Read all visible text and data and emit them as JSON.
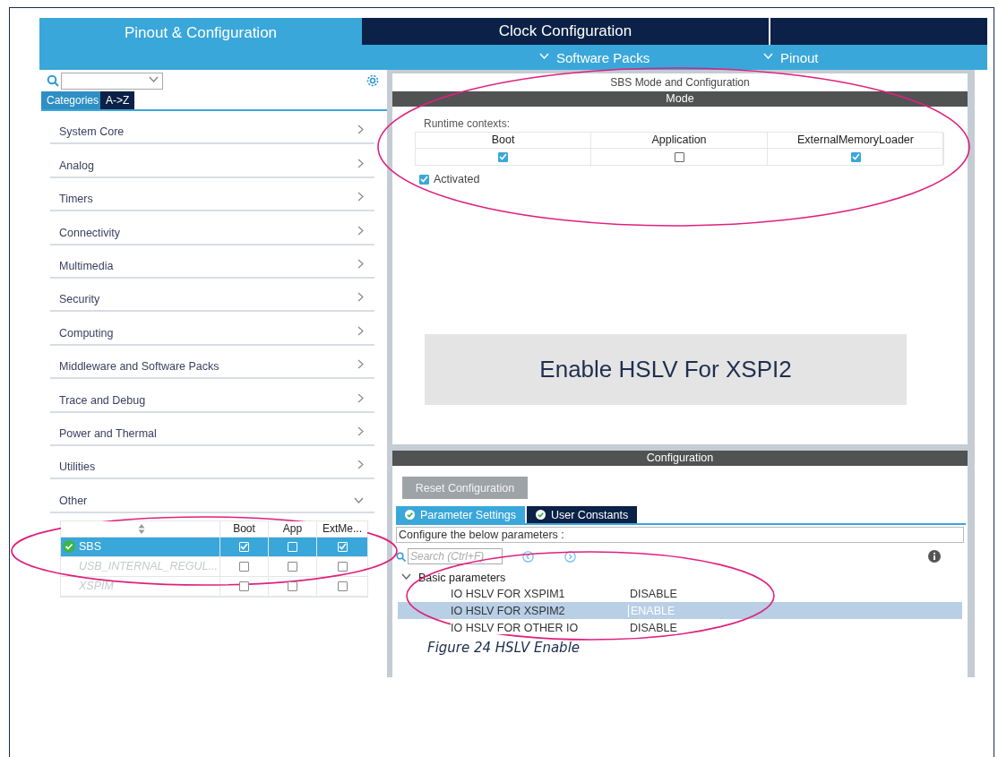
{
  "top_tabs": [
    {
      "label": "Pinout & Configuration",
      "selected": true
    },
    {
      "label": "Clock Configuration",
      "selected": false
    }
  ],
  "sub_menus": [
    {
      "label": "Software Packs"
    },
    {
      "label": "Pinout"
    }
  ],
  "sidebar": {
    "view_tabs": [
      {
        "label": "Categories",
        "selected": true
      },
      {
        "label": "A->Z",
        "selected": false
      }
    ],
    "categories": [
      {
        "label": "System Core",
        "expanded": false
      },
      {
        "label": "Analog",
        "expanded": false
      },
      {
        "label": "Timers",
        "expanded": false
      },
      {
        "label": "Connectivity",
        "expanded": false
      },
      {
        "label": "Multimedia",
        "expanded": false
      },
      {
        "label": "Security",
        "expanded": false
      },
      {
        "label": "Computing",
        "expanded": false
      },
      {
        "label": "Middleware and Software Packs",
        "expanded": false
      },
      {
        "label": "Trace and Debug",
        "expanded": false
      },
      {
        "label": "Power and Thermal",
        "expanded": false
      },
      {
        "label": "Utilities",
        "expanded": false
      },
      {
        "label": "Other",
        "expanded": true
      }
    ],
    "table": {
      "columns": [
        "Boot",
        "App",
        "ExtMe..."
      ],
      "rows": [
        {
          "name": "SBS",
          "selected": true,
          "enabled": true,
          "checks": [
            true,
            false,
            true
          ]
        },
        {
          "name": "USB_INTERNAL_REGUL...",
          "selected": false,
          "enabled": false,
          "checks": [
            false,
            false,
            false
          ]
        },
        {
          "name": "XSPIM",
          "selected": false,
          "enabled": false,
          "checks": [
            false,
            false,
            false
          ]
        }
      ]
    }
  },
  "mode_panel": {
    "title": "SBS Mode and Configuration",
    "header": "Mode",
    "runtime_label": "Runtime contexts:",
    "contexts": [
      {
        "label": "Boot",
        "checked": true
      },
      {
        "label": "Application",
        "checked": false
      },
      {
        "label": "ExternalMemoryLoader",
        "checked": true
      }
    ],
    "activated": {
      "label": "Activated",
      "checked": true
    }
  },
  "banner": "Enable HSLV For XSPI2",
  "config": {
    "header": "Configuration",
    "reset_button": "Reset Configuration",
    "tabs": [
      {
        "label": "Parameter Settings",
        "selected": true
      },
      {
        "label": "User Constants",
        "selected": false
      }
    ],
    "description": "Configure the below parameters :",
    "search_placeholder": "Search (Ctrl+F)",
    "group": {
      "label": "Basic parameters",
      "expanded": true,
      "children": [
        {
          "name": "IO HSLV FOR XSPIM1",
          "value": "DISABLE",
          "selected": false
        },
        {
          "name": "IO HSLV FOR XSPIM2",
          "value": "ENABLE",
          "selected": true
        },
        {
          "name": "IO HSLV FOR OTHER IO",
          "value": "DISABLE",
          "selected": false
        }
      ]
    }
  },
  "caption": "Figure 24 HSLV Enable"
}
